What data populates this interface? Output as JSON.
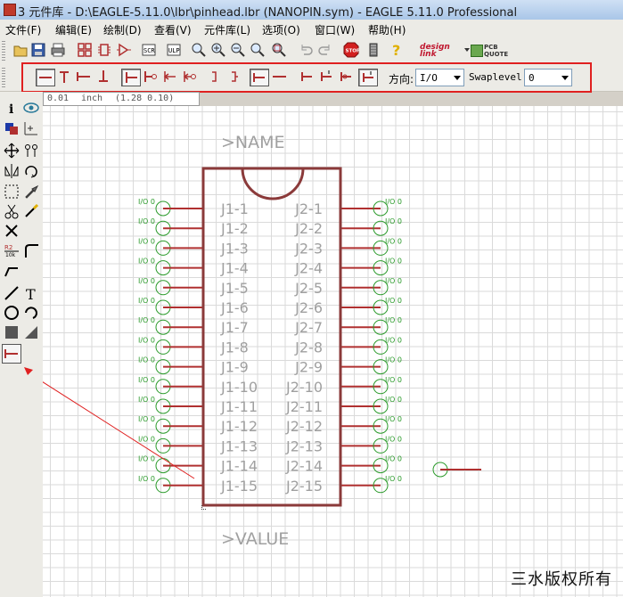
{
  "window": {
    "title": "3 元件库 - D:\\EAGLE-5.11.0\\lbr\\pinhead.lbr (NANOPIN.sym) - EAGLE 5.11.0 Professional"
  },
  "menu": [
    {
      "label": "文件(F)"
    },
    {
      "label": "编辑(E)"
    },
    {
      "label": "绘制(D)"
    },
    {
      "label": "查看(V)"
    },
    {
      "label": "元件库(L)"
    },
    {
      "label": "选项(O)"
    },
    {
      "label": "窗口(W)"
    },
    {
      "label": "帮助(H)"
    }
  ],
  "toolbar": {
    "brand": "design link",
    "pcb_quote": "PCB QUOTE"
  },
  "pin_params": {
    "direction_label": "方向:",
    "direction_value": "I/O",
    "swaplevel_label": "Swaplevel:",
    "swaplevel_value": "0"
  },
  "status": {
    "grid": "0.01",
    "unit": "inch",
    "coords": "(1.28  0.10)"
  },
  "symbol": {
    "name_text": ">NAME",
    "value_text": ">VALUE",
    "pin_direction": "I/O",
    "pin_swap": "0",
    "left_pins": [
      "J1-1",
      "J1-2",
      "J1-3",
      "J1-4",
      "J1-5",
      "J1-6",
      "J1-7",
      "J1-8",
      "J1-9",
      "J1-10",
      "J1-11",
      "J1-12",
      "J1-13",
      "J1-14",
      "J1-15"
    ],
    "right_pins": [
      "J2-1",
      "J2-2",
      "J2-3",
      "J2-4",
      "J2-5",
      "J2-6",
      "J2-7",
      "J2-8",
      "J2-9",
      "J2-10",
      "J2-11",
      "J2-12",
      "J2-13",
      "J2-14",
      "J2-15"
    ]
  },
  "watermark": "三水版权所有",
  "colors": {
    "outline": "#8b3a3a",
    "pin_line": "#b03030",
    "pin_circle": "#2a9a2a",
    "label": "#a0a0a0",
    "highlight": "#e02020"
  }
}
